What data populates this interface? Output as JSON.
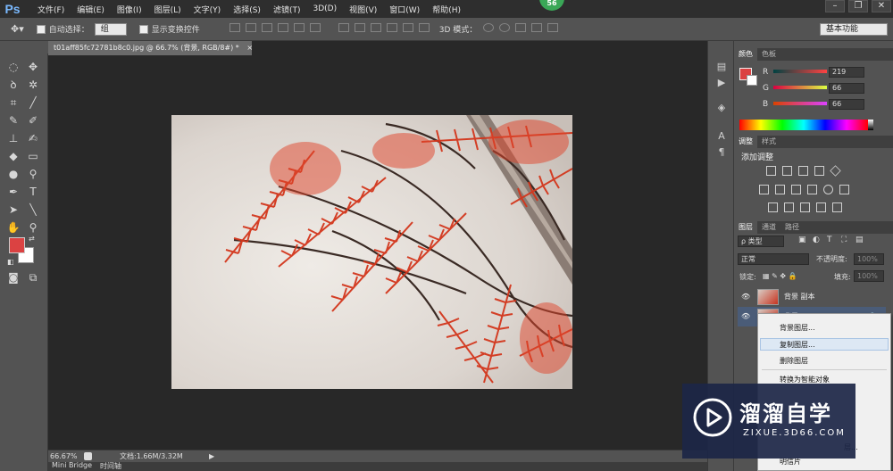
{
  "app": {
    "logo": "Ps",
    "badge": "56"
  },
  "menu": [
    "文件(F)",
    "编辑(E)",
    "图像(I)",
    "图层(L)",
    "文字(Y)",
    "选择(S)",
    "滤镜(T)",
    "3D(D)",
    "视图(V)",
    "窗口(W)",
    "帮助(H)"
  ],
  "options": {
    "auto_select_label": "自动选择：",
    "auto_select_value": "组",
    "show_transform_label": "显示变换控件",
    "mode3d_label": "3D 模式：",
    "workspace": "基本功能"
  },
  "document": {
    "tab_title": "t01aff85fc72781b8c0.jpg @ 66.7% (背景, RGB/8#) *",
    "close": "×"
  },
  "status": {
    "zoom": "66.67%",
    "doc_info": "文档:1.66M/3.32M"
  },
  "bottom_tabs": [
    "Mini Bridge",
    "时间轴"
  ],
  "color_panel": {
    "tabs": [
      "颜色",
      "色板"
    ],
    "r_label": "R",
    "g_label": "G",
    "b_label": "B",
    "r": "219",
    "g": "66",
    "b": "66",
    "fg_color": "#db4242",
    "bg_color": "#ffffff"
  },
  "adjust_panel": {
    "tabs": [
      "调整",
      "样式"
    ],
    "title": "添加调整"
  },
  "layers_panel": {
    "tabs": [
      "图层",
      "通道",
      "路径"
    ],
    "filter_label": "ρ 类型",
    "blend_mode": "正常",
    "opacity_label": "不透明度:",
    "opacity": "100%",
    "lock_label": "锁定:",
    "fill_label": "填充:",
    "fill": "100%",
    "layers": [
      {
        "name": "背景 副本"
      },
      {
        "name": "背景"
      }
    ]
  },
  "context_menu": {
    "items": [
      "背景图层...",
      "复制图层...",
      "删除图层",
      "转换为智能对象",
      "明信片"
    ],
    "partial_item": "层...",
    "highlighted": "复制图层..."
  },
  "watermark": {
    "title": "溜溜自学",
    "url": "ZIXUE.3D66.COM"
  }
}
